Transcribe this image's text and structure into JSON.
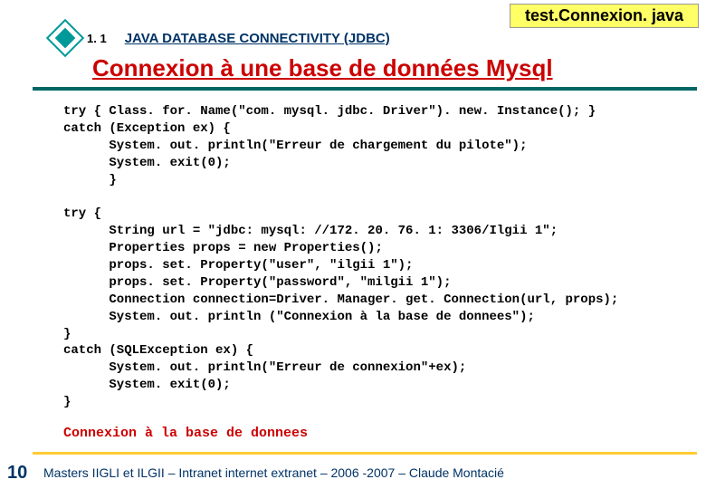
{
  "filename": "test.Connexion. java",
  "section": {
    "number": "1. 1",
    "label": "JAVA DATABASE CONNECTIVITY (JDBC)"
  },
  "title": "Connexion à une base de données Mysql",
  "code": "try { Class. for. Name(\"com. mysql. jdbc. Driver\"). new. Instance(); }\ncatch (Exception ex) {\n      System. out. println(\"Erreur de chargement du pilote\");\n      System. exit(0);\n      }\n\ntry {\n      String url = \"jdbc: mysql: //172. 20. 76. 1: 3306/Ilgii 1\";\n      Properties props = new Properties();\n      props. set. Property(\"user\", \"ilgii 1\");\n      props. set. Property(\"password\", \"milgii 1\");\n      Connection connection=Driver. Manager. get. Connection(url, props);\n      System. out. println (\"Connexion à la base de donnees\");\n}\ncatch (SQLException ex) {\n      System. out. println(\"Erreur de connexion\"+ex);\n      System. exit(0);\n}",
  "output": "Connexion à la base de donnees",
  "page_number": "10",
  "footer": "Masters IIGLI et ILGII – Intranet internet extranet – 2006 -2007 – Claude Montacié"
}
